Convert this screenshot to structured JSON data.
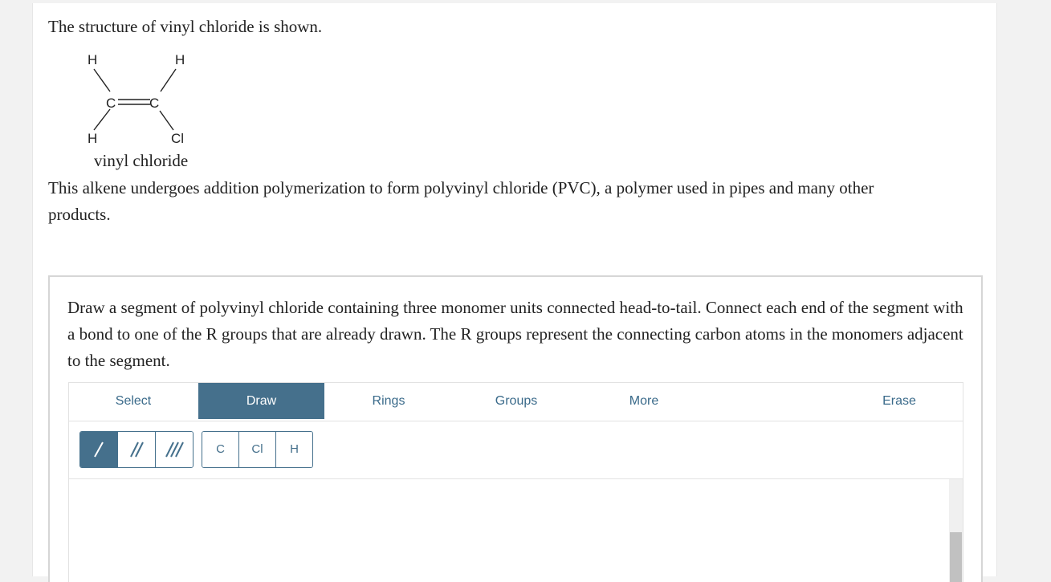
{
  "intro": "The structure of vinyl chloride is shown.",
  "structure": {
    "atoms": {
      "h_top_left": "H",
      "h_top_right": "H",
      "c_left": "C",
      "c_right": "C",
      "h_bottom_left": "H",
      "cl_bottom_right": "Cl"
    },
    "label": "vinyl chloride"
  },
  "description": "This alkene undergoes addition polymerization to form polyvinyl chloride (PVC), a polymer used in pipes and many other products.",
  "question": "Draw a segment of polyvinyl chloride containing three monomer units connected head-to-tail. Connect each end of the segment with a bond to one of the R groups that are already drawn. The R groups represent the connecting carbon atoms in the monomers adjacent to the segment.",
  "editor": {
    "tabs": {
      "select": "Select",
      "draw": "Draw",
      "rings": "Rings",
      "groups": "Groups",
      "more": "More",
      "erase": "Erase"
    },
    "active_tab": "Draw",
    "bond_tools": [
      "single-bond",
      "double-bond",
      "triple-bond"
    ],
    "selected_bond": "single-bond",
    "atoms": [
      "C",
      "Cl",
      "H"
    ]
  },
  "colors": {
    "accent": "#45708c",
    "tab_text": "#3a6a8a",
    "background": "#f2f2f2"
  }
}
